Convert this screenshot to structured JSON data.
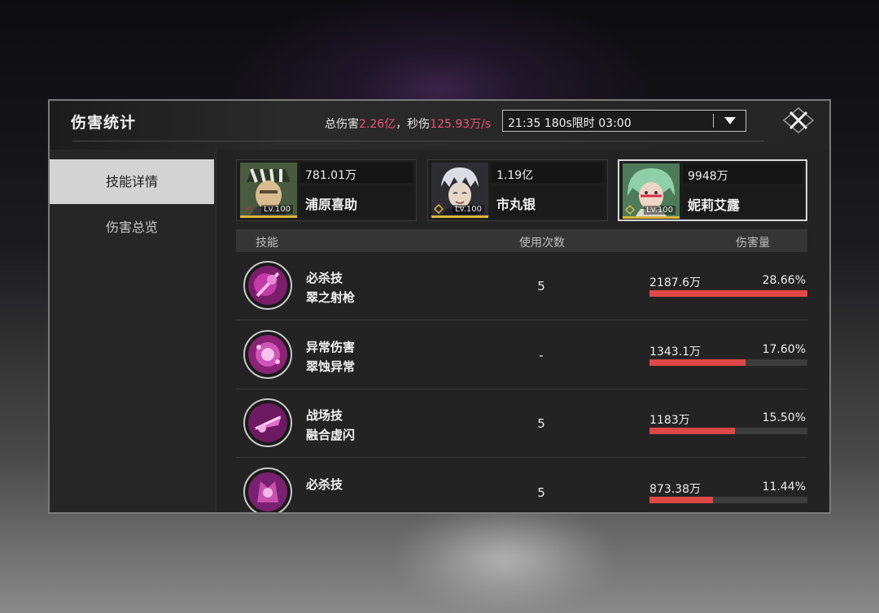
{
  "header": {
    "title": "伤害统计",
    "stats_prefix": "总伤害",
    "total_damage": "2.26亿",
    "stats_middle": "，秒伤",
    "dps": "125.93万/s",
    "dropdown_value": "21:35 180s限时 03:00"
  },
  "sidebar": {
    "items": [
      {
        "label": "技能详情",
        "active": true
      },
      {
        "label": "伤害总览",
        "active": false
      }
    ]
  },
  "characters": [
    {
      "damage": "781.01万",
      "name": "浦原喜助",
      "level": "Lv.100",
      "element_color": "#e0263c"
    },
    {
      "damage": "1.19亿",
      "name": "市丸银",
      "level": "Lv.100",
      "element_color": "#d9b73a"
    },
    {
      "damage": "9948万",
      "name": "妮莉艾露",
      "level": "Lv.100",
      "element_color": "#d9b73a"
    }
  ],
  "table": {
    "headers": {
      "skill": "技能",
      "uses": "使用次数",
      "damage": "伤害量"
    },
    "rows": [
      {
        "type": "必杀技",
        "name": "翠之射枪",
        "uses": "5",
        "amount": "2187.6万",
        "percent": "28.66%",
        "fill": 1.0
      },
      {
        "type": "异常伤害",
        "name": "翠蚀异常",
        "uses": "-",
        "amount": "1343.1万",
        "percent": "17.60%",
        "fill": 0.61
      },
      {
        "type": "战场技",
        "name": "融合虚闪",
        "uses": "5",
        "amount": "1183万",
        "percent": "15.50%",
        "fill": 0.54
      },
      {
        "type": "必杀技",
        "name": "",
        "uses": "5",
        "amount": "873.38万",
        "percent": "11.44%",
        "fill": 0.4
      }
    ]
  },
  "colors": {
    "accent_pink": "#ec4f7c",
    "bar_red": "#e04848",
    "skill_icon_purple": "#b0308e"
  }
}
